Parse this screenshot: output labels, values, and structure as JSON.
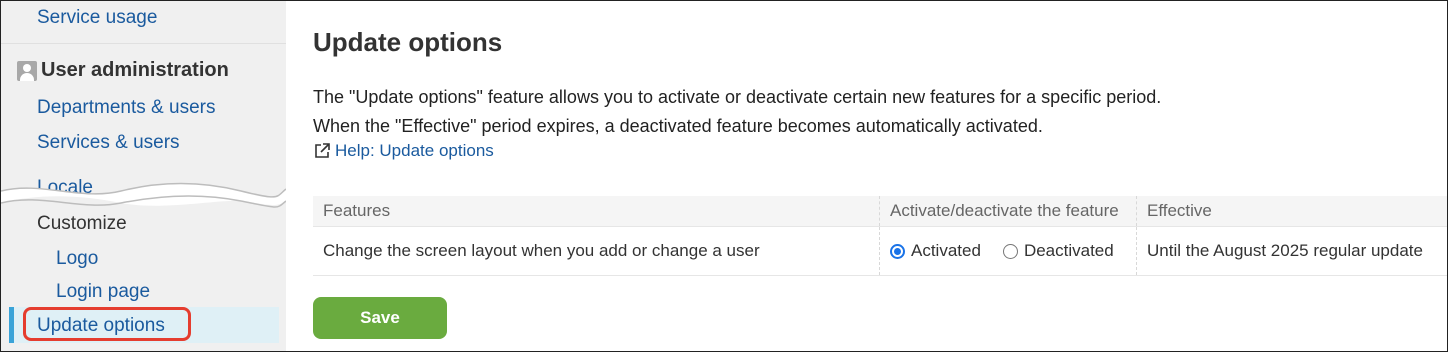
{
  "sidebar": {
    "service_usage": "Service usage",
    "user_admin": {
      "icon": "user-icon",
      "label": "User administration"
    },
    "departments_users": "Departments & users",
    "services_users": "Services & users",
    "locale": "Locale",
    "customize": "Customize",
    "logo": "Logo",
    "login_page": "Login page",
    "update_options": "Update options"
  },
  "main": {
    "title": "Update options",
    "description_line1": "The \"Update options\" feature allows you to activate or deactivate certain new features for a specific period.",
    "description_line2": "When the \"Effective\" period expires, a deactivated feature becomes automatically activated.",
    "help": {
      "icon": "external-link-icon",
      "label": "Help: Update options"
    },
    "table": {
      "headers": [
        "Features",
        "Activate/deactivate the feature",
        "Effective"
      ],
      "rows": [
        {
          "feature": "Change the screen layout when you add or change a user",
          "options": [
            "Activated",
            "Deactivated"
          ],
          "selected": "Activated",
          "effective": "Until the August 2025 regular update"
        }
      ]
    },
    "save_label": "Save"
  },
  "colors": {
    "link": "#1a5a9e",
    "save_button": "#6aab3f",
    "highlight_outline": "#e53d2f",
    "active_indicator": "#3aa3d8",
    "radio_selected": "#1a73e8"
  }
}
